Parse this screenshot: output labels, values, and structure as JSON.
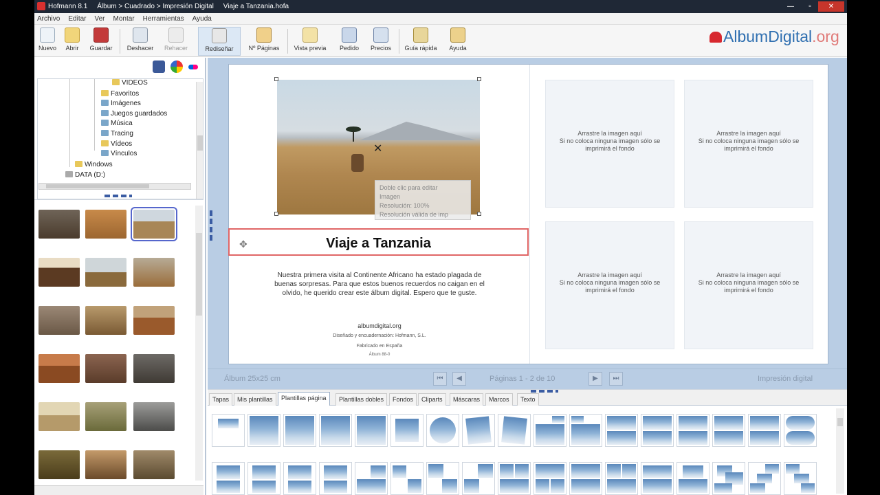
{
  "window": {
    "title_parts": [
      "Hofmann 8.1",
      "Álbum > Cuadrado > Impresión Digital",
      "Viaje a Tanzania.hofa"
    ]
  },
  "menu": [
    "Archivo",
    "Editar",
    "Ver",
    "Montar",
    "Herramientas",
    "Ayuda"
  ],
  "toolbar": [
    {
      "label": "Nuevo",
      "icon": "new-icon"
    },
    {
      "label": "Abrir",
      "icon": "open-icon"
    },
    {
      "label": "Guardar",
      "icon": "save-icon"
    },
    {
      "label": "Deshacer",
      "icon": "undo-icon"
    },
    {
      "label": "Rehacer",
      "icon": "redo-icon"
    },
    {
      "label": "Rediseñar",
      "icon": "redesign-icon"
    },
    {
      "label": "Nº Páginas",
      "icon": "pages-icon"
    },
    {
      "label": "Vista previa",
      "icon": "preview-icon"
    },
    {
      "label": "Pedido",
      "icon": "order-icon"
    },
    {
      "label": "Precios",
      "icon": "prices-icon"
    },
    {
      "label": "Guía rápida",
      "icon": "guide-icon"
    },
    {
      "label": "Ayuda",
      "icon": "help-icon"
    }
  ],
  "logo": {
    "main": "AlbumDigital",
    "suffix": ".org"
  },
  "tree": [
    "VIDEOS",
    "Favoritos",
    "Imágenes",
    "Juegos guardados",
    "Música",
    "Tracing",
    "Vídeos",
    "Vínculos",
    "Windows",
    "DATA (D:)"
  ],
  "canvas": {
    "title": "Viaje a Tanzania",
    "tooltip": [
      "Doble clic para editar",
      "Imagen",
      "Resolución: 100%",
      "Resolución válida de imp"
    ],
    "body": "Nuestra primera visita al Continente Africano ha estado plagada de buenas sorpresas. Para que estos buenos recuerdos no caigan en el olvido, he querido crear este álbum digital. Espero que te guste.",
    "footer1": "albumdigital.org",
    "footer2": "Diseñado y encuadernación: Hofmann, S.L.",
    "footer3": "Fabricado en España",
    "footer4": "Álbum 88-0"
  },
  "drop_text": [
    "Arrastre la imagen aquí",
    "Si no coloca ninguna imagen sólo se",
    "imprimirá el fondo"
  ],
  "nav": {
    "album_size": "Álbum 25x25 cm",
    "pages": "Páginas 1 - 2 de 10",
    "print_type": "Impresión digital"
  },
  "tabs": [
    "Tapas",
    "Mis plantillas",
    "Plantillas página",
    "Plantillas dobles",
    "Fondos",
    "Cliparts",
    "Máscaras",
    "Marcos",
    "Texto"
  ],
  "colors": {
    "accent": "#3a5ca3",
    "selection": "#e06565",
    "canvas_bg": "#b9cde4"
  }
}
